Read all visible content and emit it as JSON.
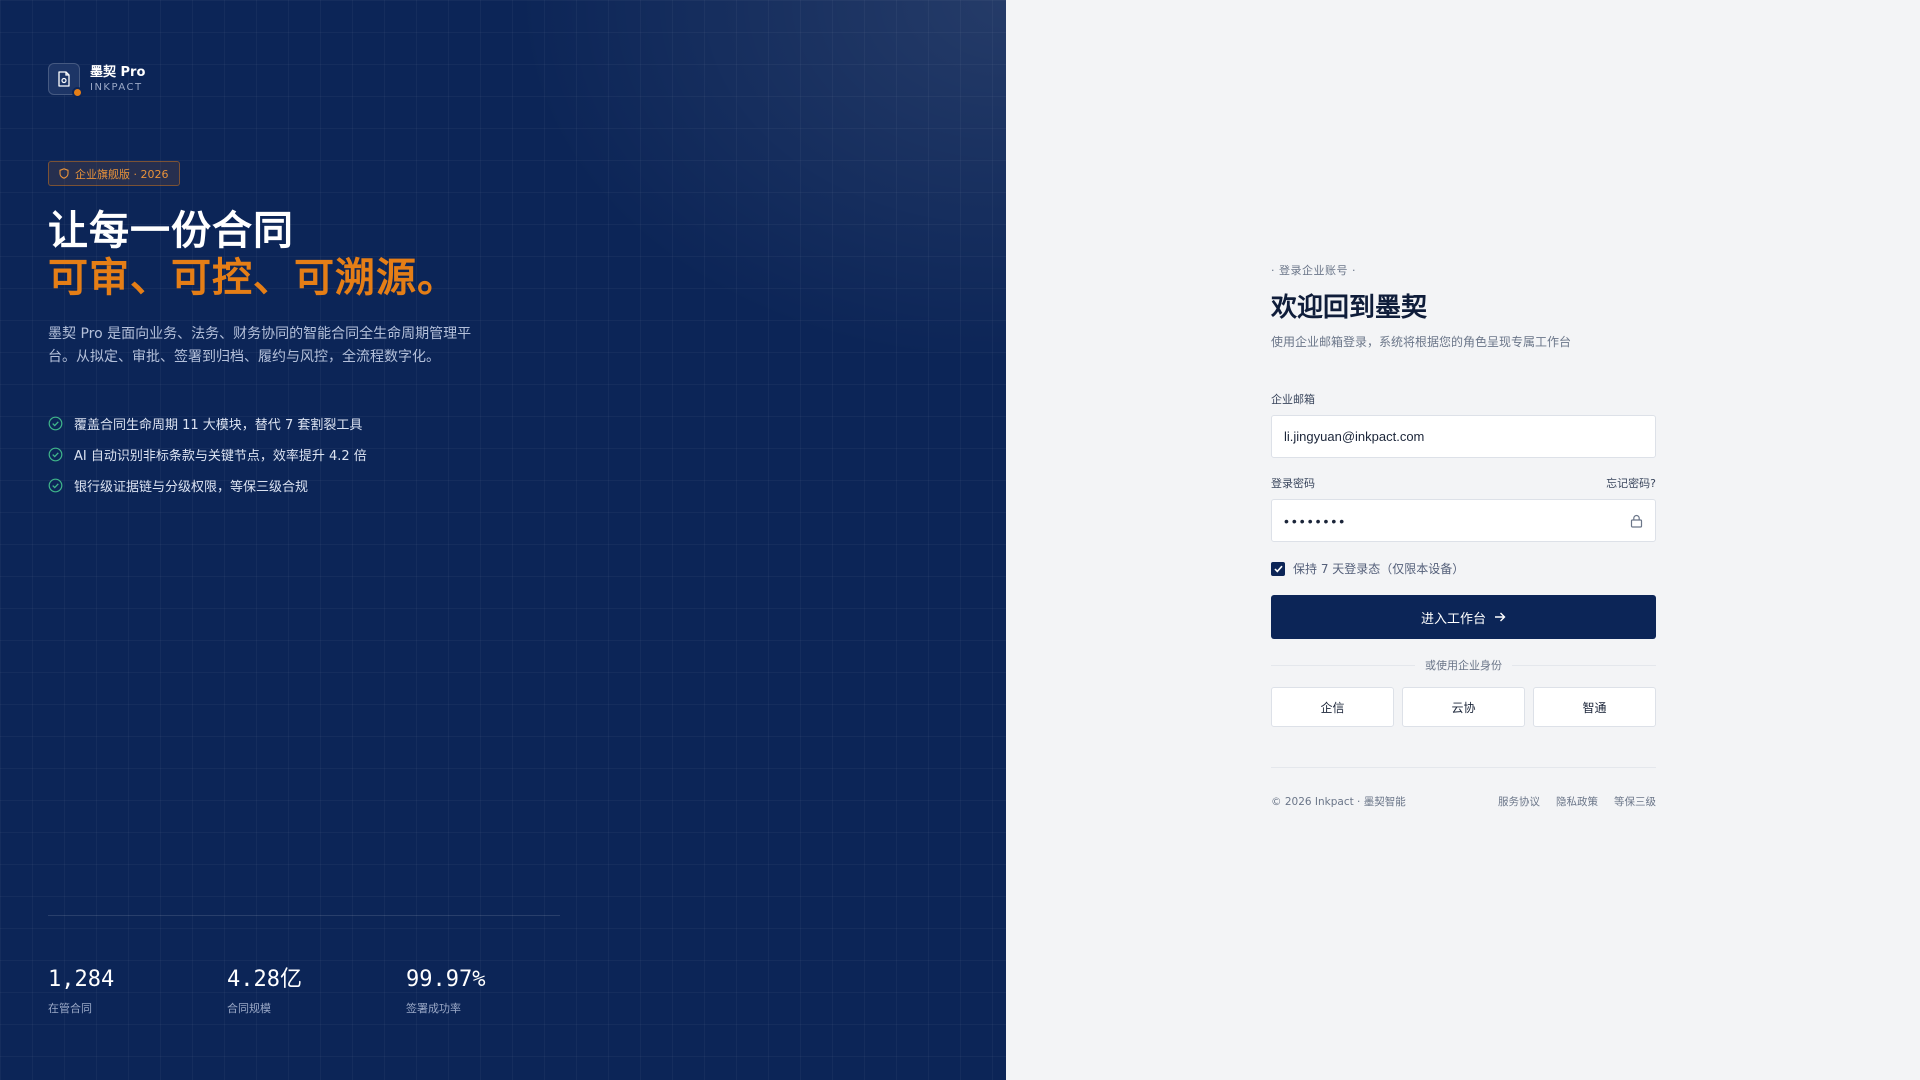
{
  "brand": {
    "name": "墨契 Pro",
    "subtitle": "INKPACT"
  },
  "hero": {
    "badge": "企业旗舰版 · 2026",
    "headline_line1": "让每一份合同",
    "headline_line2": "可审、可控、可溯源。",
    "description": "墨契 Pro 是面向业务、法务、财务协同的智能合同全生命周期管理平台。从拟定、审批、签署到归档、履约与风控，全流程数字化。",
    "features": [
      "覆盖合同生命周期 11 大模块，替代 7 套割裂工具",
      "AI 自动识别非标条款与关键节点，效率提升 4.2 倍",
      "银行级证据链与分级权限，等保三级合规"
    ],
    "stats": [
      {
        "value": "1,284",
        "label": "在管合同"
      },
      {
        "value": "4.28亿",
        "label": "合同规模"
      },
      {
        "value": "99.97%",
        "label": "签署成功率"
      }
    ]
  },
  "login": {
    "eyebrow": "· 登录企业账号 ·",
    "title": "欢迎回到墨契",
    "subtitle": "使用企业邮箱登录，系统将根据您的角色呈现专属工作台",
    "email_label": "企业邮箱",
    "email_value": "li.jingyuan@inkpact.com",
    "password_label": "登录密码",
    "forgot_label": "忘记密码?",
    "password_value": "••••••••",
    "remember_label": "保持 7 天登录态（仅限本设备）",
    "remember_checked": true,
    "submit_label": "进入工作台",
    "divider_label": "或使用企业身份",
    "sso_options": [
      "企信",
      "云协",
      "智通"
    ]
  },
  "footer": {
    "copyright": "© 2026 Inkpact · 墨契智能",
    "links": [
      "服务协议",
      "隐私政策",
      "等保三级"
    ]
  },
  "colors": {
    "navy": "#0c2557",
    "accent": "#e57e16",
    "background": "#f3f4f6",
    "success": "#3fb58a"
  },
  "icons": {
    "brand": "document-icon",
    "badge": "shield-icon",
    "feature": "check-circle-icon",
    "password": "lock-icon",
    "submit": "arrow-right-icon"
  }
}
